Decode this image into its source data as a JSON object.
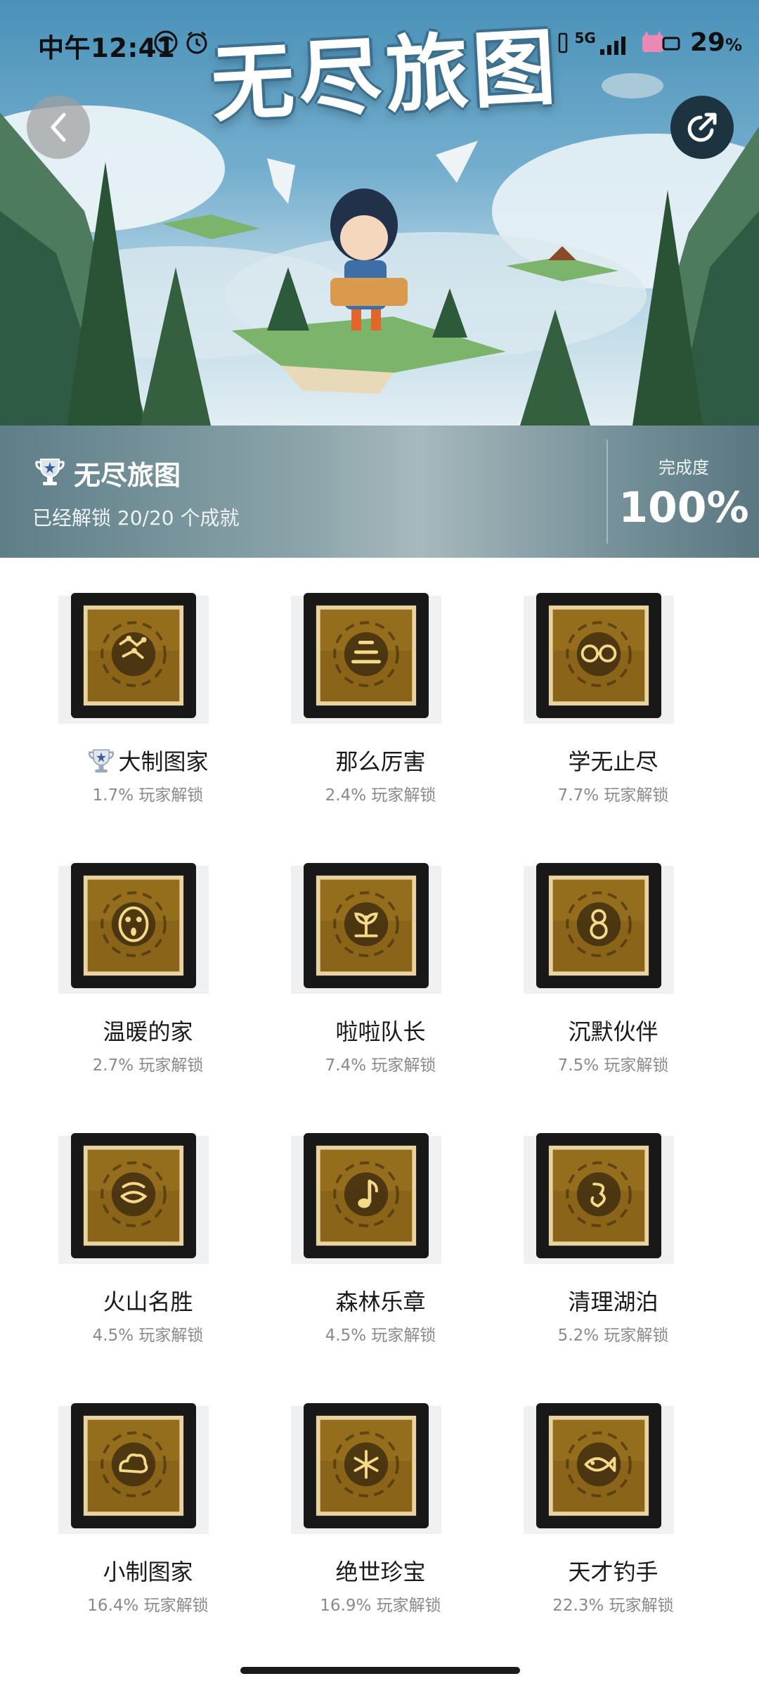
{
  "status_bar": {
    "time": "中午12:41",
    "network": "5G",
    "battery": "29",
    "battery_unit": "%"
  },
  "banner": {
    "logo_text": "无尽旅图"
  },
  "header": {
    "game_name": "无尽旅图",
    "unlock_summary": "已经解锁 20/20 个成就",
    "completion_label": "完成度",
    "completion_value": "100%"
  },
  "achievements": [
    {
      "title": "大制图家",
      "rate": "1.7% 玩家解锁",
      "rare": true,
      "icon": "constellation-glyph-icon"
    },
    {
      "title": "那么厉害",
      "rate": "2.4% 玩家解锁",
      "icon": "stacked-lines-glyph-icon"
    },
    {
      "title": "学无止尽",
      "rate": "7.7% 玩家解锁",
      "icon": "glasses-glyph-icon"
    },
    {
      "title": "温暖的家",
      "rate": "2.7% 玩家解锁",
      "icon": "face-glyph-icon"
    },
    {
      "title": "啦啦队长",
      "rate": "7.4% 玩家解锁",
      "icon": "sprout-glyph-icon"
    },
    {
      "title": "沉默伙伴",
      "rate": "7.5% 玩家解锁",
      "icon": "figure-eight-glyph-icon"
    },
    {
      "title": "火山名胜",
      "rate": "4.5% 玩家解锁",
      "icon": "volcano-glyph-icon"
    },
    {
      "title": "森林乐章",
      "rate": "4.5% 玩家解锁",
      "icon": "music-note-glyph-icon"
    },
    {
      "title": "清理湖泊",
      "rate": "5.2% 玩家解锁",
      "icon": "lake-glyph-icon"
    },
    {
      "title": "小制图家",
      "rate": "16.4% 玩家解锁",
      "icon": "cloud-glyph-icon"
    },
    {
      "title": "绝世珍宝",
      "rate": "16.9% 玩家解锁",
      "icon": "snowflake-glyph-icon"
    },
    {
      "title": "天才钓手",
      "rate": "22.3% 玩家解锁",
      "icon": "fish-glyph-icon"
    }
  ],
  "colors": {
    "tile_gold": "#8a6418",
    "tile_border": "#f0dcae",
    "glyph": "#f4d98a",
    "rate_text": "#8a8a8a"
  }
}
